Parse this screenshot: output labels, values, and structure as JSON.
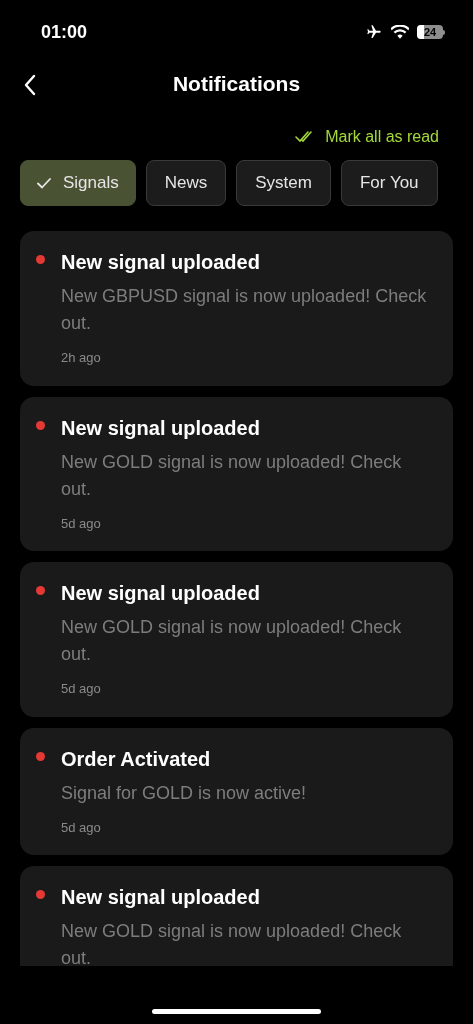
{
  "status_bar": {
    "time": "01:00",
    "battery": "24"
  },
  "header": {
    "title": "Notifications"
  },
  "mark_all": {
    "label": "Mark all as read"
  },
  "tabs": [
    {
      "label": "Signals",
      "selected": true
    },
    {
      "label": "News",
      "selected": false
    },
    {
      "label": "System",
      "selected": false
    },
    {
      "label": "For You",
      "selected": false
    }
  ],
  "notifications": [
    {
      "title": "New signal uploaded",
      "body": "New GBPUSD signal is now uploaded! Check out.",
      "time": "2h ago",
      "unread": true
    },
    {
      "title": "New signal uploaded",
      "body": "New GOLD signal is now uploaded! Check out.",
      "time": "5d ago",
      "unread": true
    },
    {
      "title": "New signal uploaded",
      "body": "New GOLD signal is now uploaded! Check out.",
      "time": "5d ago",
      "unread": true
    },
    {
      "title": "Order Activated",
      "body": "Signal for GOLD is now active!",
      "time": "5d ago",
      "unread": true
    },
    {
      "title": "New signal uploaded",
      "body": "New GOLD signal is now uploaded! Check out.",
      "unread": true
    }
  ]
}
